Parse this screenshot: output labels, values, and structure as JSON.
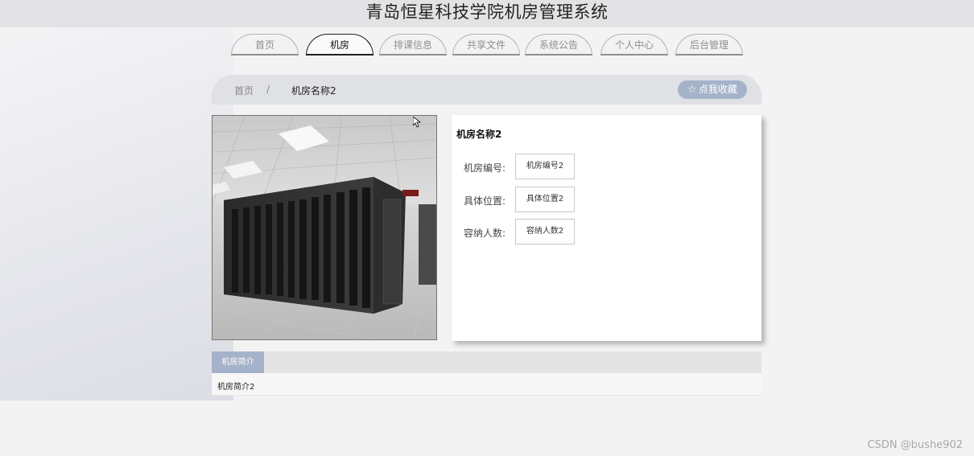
{
  "app": {
    "title": "青岛恒星科技学院机房管理系统"
  },
  "nav": {
    "tabs": [
      {
        "label": "首页"
      },
      {
        "label": "机房"
      },
      {
        "label": "排课信息"
      },
      {
        "label": "共享文件"
      },
      {
        "label": "系统公告"
      },
      {
        "label": "个人中心"
      },
      {
        "label": "后台管理"
      }
    ],
    "active_tab": "机房"
  },
  "breadcrumb": {
    "home": "首页",
    "separator": "/",
    "current": "机房名称2"
  },
  "favorite": {
    "icon": "star-icon",
    "label": "点我收藏"
  },
  "detail": {
    "name": "机房名称2",
    "fields": [
      {
        "label": "机房编号:",
        "value": "机房编号2"
      },
      {
        "label": "具体位置:",
        "value": "具体位置2"
      },
      {
        "label": "容纳人数:",
        "value": "容纳人数2"
      }
    ]
  },
  "intro": {
    "tab_label": "机房简介",
    "content": "机房简介2"
  },
  "watermark": "CSDN @bushe902",
  "colors": {
    "accent": "#a5b3ca",
    "title_bar": "#e3e3e6",
    "breadcrumb_bar": "#e0e1e5"
  }
}
